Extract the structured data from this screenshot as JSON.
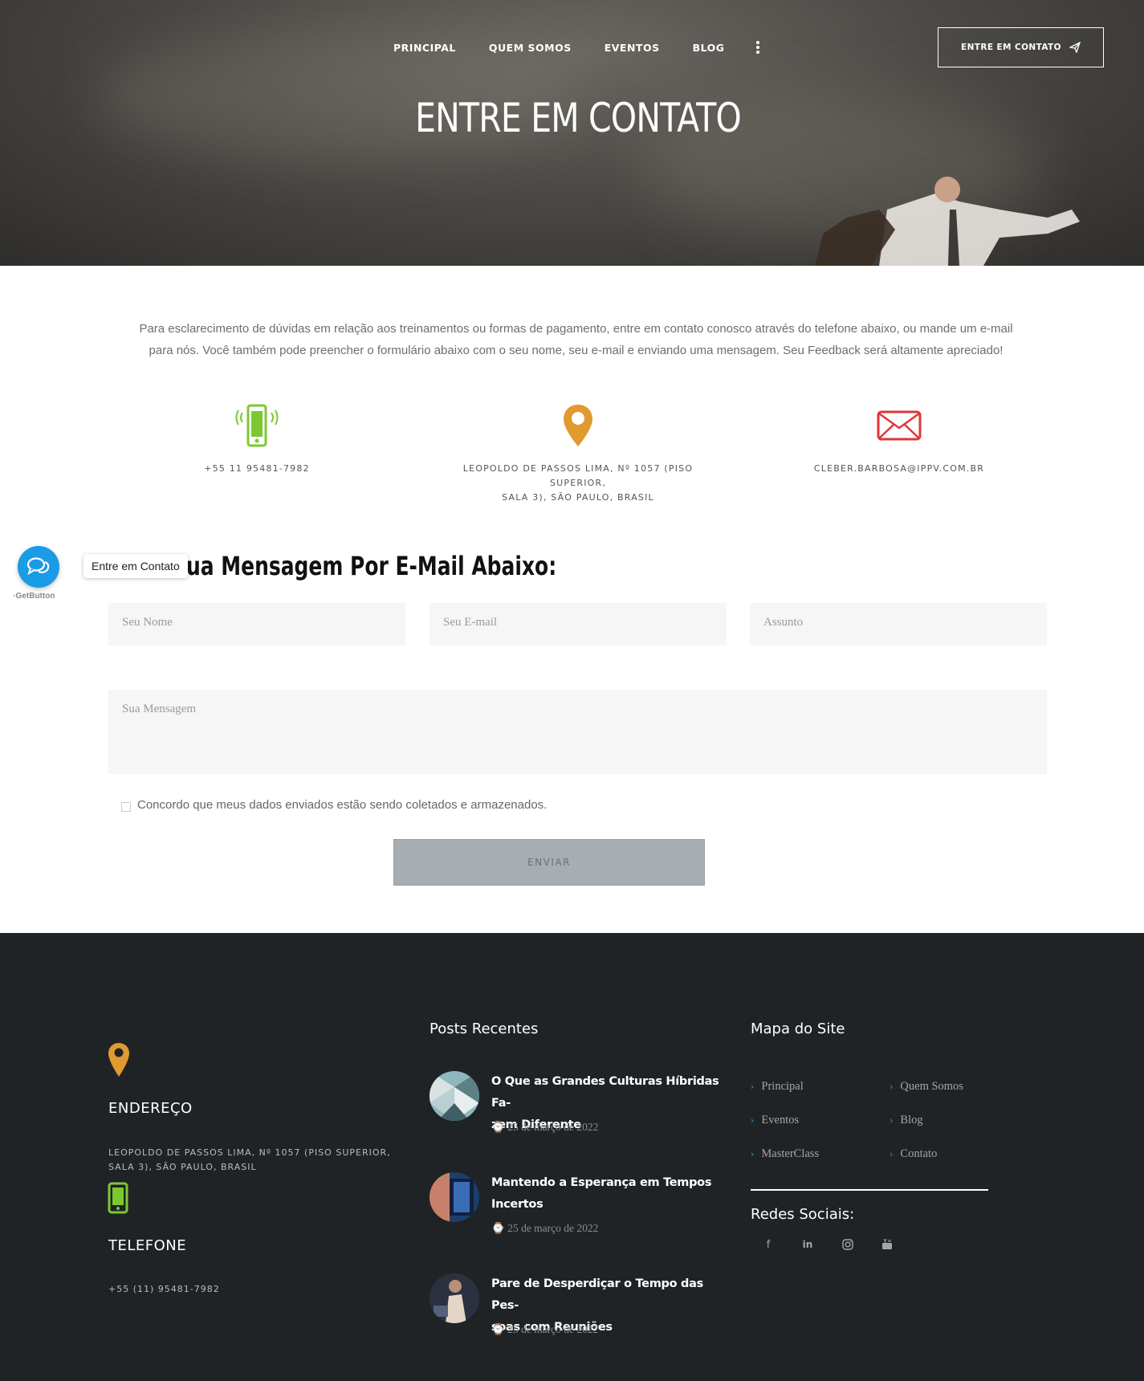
{
  "nav": {
    "items": [
      "PRINCIPAL",
      "QUEM SOMOS",
      "EVENTOS",
      "BLOG"
    ],
    "cta_label": "ENTRE EM CONTATO"
  },
  "hero": {
    "title": "ENTRE EM CONTATO"
  },
  "intro": {
    "line1": "Para esclarecimento de dúvidas em relação aos treinamentos ou formas de pagamento, entre em contato conosco através do telefone abaixo, ou mande um e-mail",
    "line2": "para nós. Você também pode preencher o formulário abaixo com o seu nome, seu e-mail e enviando uma mensagem. Seu Feedback será altamente apreciado!"
  },
  "contact_info": {
    "phone": "+55 11 95481-7982",
    "address_line1": "LEOPOLDO DE PASSOS LIMA, Nº 1057 (PISO SUPERIOR,",
    "address_line2": "SALA 3), SÃO PAULO, BRASIL",
    "email": "CLEBER.BARBOSA@IPPV.COM.BR"
  },
  "form": {
    "title": "ua Mensagem Por E-Mail Abaixo:",
    "name_placeholder": "Seu Nome",
    "email_placeholder": "Seu E-mail",
    "subject_placeholder": "Assunto",
    "message_placeholder": "Sua Mensagem",
    "consent_label": "Concordo que meus dados enviados estão sendo coletados e armazenados.",
    "submit_label": "ENVIAR"
  },
  "getbutton": {
    "tooltip": "Entre em Contato",
    "brand": "GetButton"
  },
  "footer": {
    "address_heading": "ENDEREÇO",
    "address_line1": "LEOPOLDO DE PASSOS LIMA, Nº 1057 (PISO SUPERIOR,",
    "address_line2": "SALA 3), SÃO PAULO, BRASIL",
    "phone_heading": "TELEFONE",
    "phone": "+55 (11) 95481-7982",
    "recent_posts_heading": "Posts Recentes",
    "posts": [
      {
        "title_line1": "O Que as Grandes Culturas Híbridas Fa-",
        "title_line2": "zem Diferente",
        "date": "25 de março de 2022"
      },
      {
        "title_line1": "Mantendo a Esperança em Tempos",
        "title_line2": "Incertos",
        "date": "25 de março de 2022"
      },
      {
        "title_line1": "Pare de Desperdiçar o Tempo das Pes-",
        "title_line2": "soas com Reuniões",
        "date": "25 de março de 2022"
      }
    ],
    "sitemap_heading": "Mapa do Site",
    "sitemap": [
      "Principal",
      "Quem Somos",
      "Eventos",
      "Blog",
      "MasterClass",
      "Contato"
    ],
    "social_heading": "Redes Sociais:",
    "social_icons": [
      "facebook-icon",
      "linkedin-icon",
      "instagram-icon",
      "youtube-icon"
    ]
  },
  "colors": {
    "accent_blue": "#1a9be6",
    "phone_green": "#7cc832",
    "pin_orange": "#e09a30",
    "mail_red": "#e0353a",
    "footer_bg": "#202326"
  }
}
